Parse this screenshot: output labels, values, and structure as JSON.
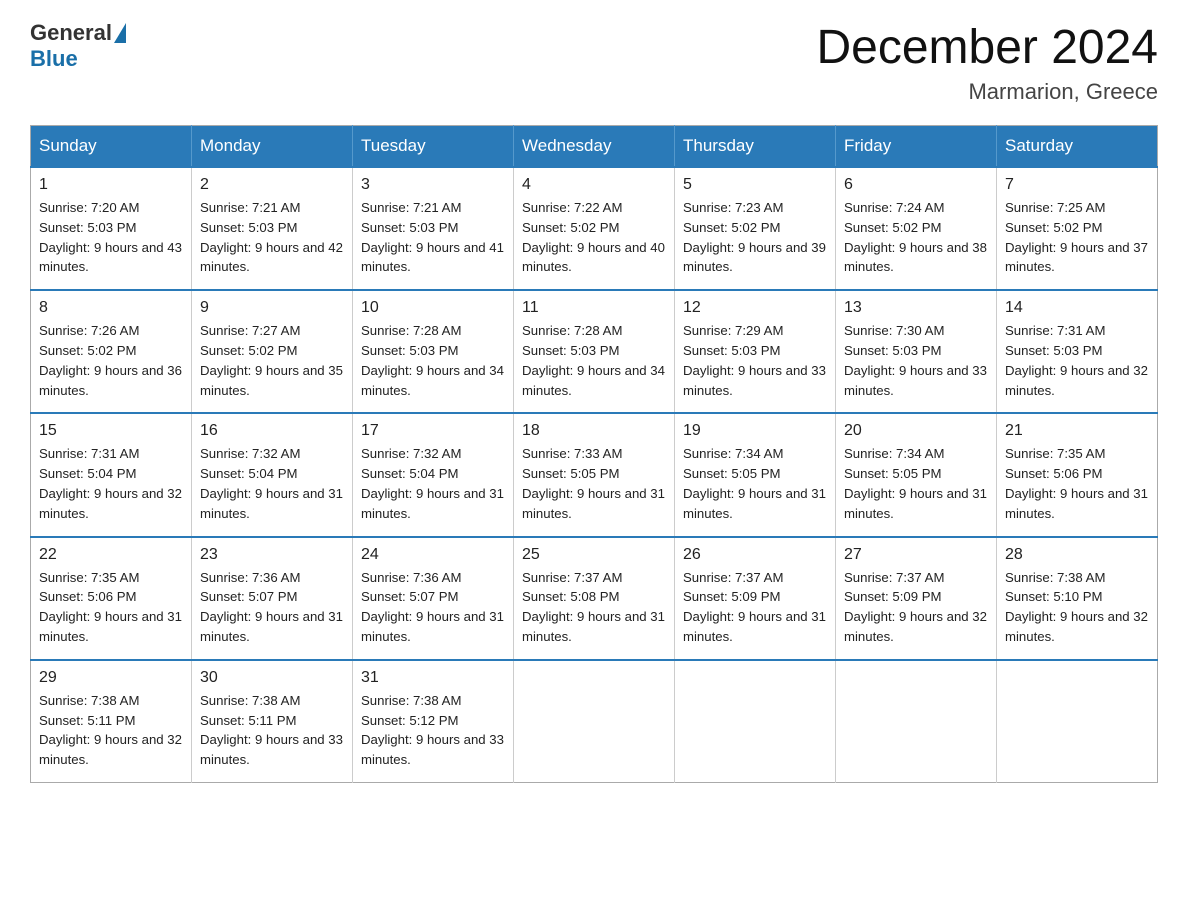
{
  "logo": {
    "general": "General",
    "blue": "Blue"
  },
  "title": "December 2024",
  "location": "Marmarion, Greece",
  "days_header": [
    "Sunday",
    "Monday",
    "Tuesday",
    "Wednesday",
    "Thursday",
    "Friday",
    "Saturday"
  ],
  "weeks": [
    [
      {
        "day": "1",
        "sunrise": "7:20 AM",
        "sunset": "5:03 PM",
        "daylight": "9 hours and 43 minutes."
      },
      {
        "day": "2",
        "sunrise": "7:21 AM",
        "sunset": "5:03 PM",
        "daylight": "9 hours and 42 minutes."
      },
      {
        "day": "3",
        "sunrise": "7:21 AM",
        "sunset": "5:03 PM",
        "daylight": "9 hours and 41 minutes."
      },
      {
        "day": "4",
        "sunrise": "7:22 AM",
        "sunset": "5:02 PM",
        "daylight": "9 hours and 40 minutes."
      },
      {
        "day": "5",
        "sunrise": "7:23 AM",
        "sunset": "5:02 PM",
        "daylight": "9 hours and 39 minutes."
      },
      {
        "day": "6",
        "sunrise": "7:24 AM",
        "sunset": "5:02 PM",
        "daylight": "9 hours and 38 minutes."
      },
      {
        "day": "7",
        "sunrise": "7:25 AM",
        "sunset": "5:02 PM",
        "daylight": "9 hours and 37 minutes."
      }
    ],
    [
      {
        "day": "8",
        "sunrise": "7:26 AM",
        "sunset": "5:02 PM",
        "daylight": "9 hours and 36 minutes."
      },
      {
        "day": "9",
        "sunrise": "7:27 AM",
        "sunset": "5:02 PM",
        "daylight": "9 hours and 35 minutes."
      },
      {
        "day": "10",
        "sunrise": "7:28 AM",
        "sunset": "5:03 PM",
        "daylight": "9 hours and 34 minutes."
      },
      {
        "day": "11",
        "sunrise": "7:28 AM",
        "sunset": "5:03 PM",
        "daylight": "9 hours and 34 minutes."
      },
      {
        "day": "12",
        "sunrise": "7:29 AM",
        "sunset": "5:03 PM",
        "daylight": "9 hours and 33 minutes."
      },
      {
        "day": "13",
        "sunrise": "7:30 AM",
        "sunset": "5:03 PM",
        "daylight": "9 hours and 33 minutes."
      },
      {
        "day": "14",
        "sunrise": "7:31 AM",
        "sunset": "5:03 PM",
        "daylight": "9 hours and 32 minutes."
      }
    ],
    [
      {
        "day": "15",
        "sunrise": "7:31 AM",
        "sunset": "5:04 PM",
        "daylight": "9 hours and 32 minutes."
      },
      {
        "day": "16",
        "sunrise": "7:32 AM",
        "sunset": "5:04 PM",
        "daylight": "9 hours and 31 minutes."
      },
      {
        "day": "17",
        "sunrise": "7:32 AM",
        "sunset": "5:04 PM",
        "daylight": "9 hours and 31 minutes."
      },
      {
        "day": "18",
        "sunrise": "7:33 AM",
        "sunset": "5:05 PM",
        "daylight": "9 hours and 31 minutes."
      },
      {
        "day": "19",
        "sunrise": "7:34 AM",
        "sunset": "5:05 PM",
        "daylight": "9 hours and 31 minutes."
      },
      {
        "day": "20",
        "sunrise": "7:34 AM",
        "sunset": "5:05 PM",
        "daylight": "9 hours and 31 minutes."
      },
      {
        "day": "21",
        "sunrise": "7:35 AM",
        "sunset": "5:06 PM",
        "daylight": "9 hours and 31 minutes."
      }
    ],
    [
      {
        "day": "22",
        "sunrise": "7:35 AM",
        "sunset": "5:06 PM",
        "daylight": "9 hours and 31 minutes."
      },
      {
        "day": "23",
        "sunrise": "7:36 AM",
        "sunset": "5:07 PM",
        "daylight": "9 hours and 31 minutes."
      },
      {
        "day": "24",
        "sunrise": "7:36 AM",
        "sunset": "5:07 PM",
        "daylight": "9 hours and 31 minutes."
      },
      {
        "day": "25",
        "sunrise": "7:37 AM",
        "sunset": "5:08 PM",
        "daylight": "9 hours and 31 minutes."
      },
      {
        "day": "26",
        "sunrise": "7:37 AM",
        "sunset": "5:09 PM",
        "daylight": "9 hours and 31 minutes."
      },
      {
        "day": "27",
        "sunrise": "7:37 AM",
        "sunset": "5:09 PM",
        "daylight": "9 hours and 32 minutes."
      },
      {
        "day": "28",
        "sunrise": "7:38 AM",
        "sunset": "5:10 PM",
        "daylight": "9 hours and 32 minutes."
      }
    ],
    [
      {
        "day": "29",
        "sunrise": "7:38 AM",
        "sunset": "5:11 PM",
        "daylight": "9 hours and 32 minutes."
      },
      {
        "day": "30",
        "sunrise": "7:38 AM",
        "sunset": "5:11 PM",
        "daylight": "9 hours and 33 minutes."
      },
      {
        "day": "31",
        "sunrise": "7:38 AM",
        "sunset": "5:12 PM",
        "daylight": "9 hours and 33 minutes."
      },
      null,
      null,
      null,
      null
    ]
  ]
}
